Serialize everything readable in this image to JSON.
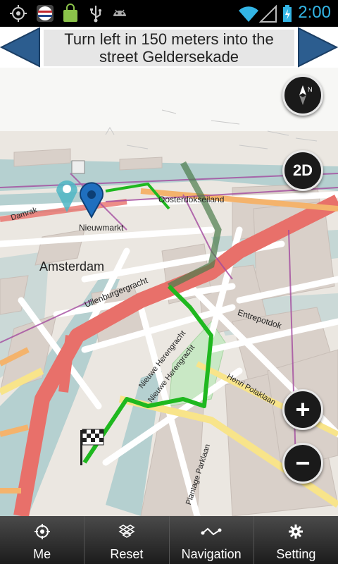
{
  "status_bar": {
    "time": "2:00",
    "icons": [
      "gps-icon",
      "flag-app-icon",
      "shopping-bag-icon",
      "usb-icon",
      "android-icon",
      "wifi-icon",
      "signal-icon",
      "battery-icon"
    ]
  },
  "instruction": {
    "text": "Turn left in 150 meters into the street Geldersekade",
    "prev_icon": "left-arrow-icon",
    "next_icon": "right-arrow-icon"
  },
  "map": {
    "labels": {
      "nieuwmarkt": "Nieuwmarkt",
      "amsterdam": "Amsterdam",
      "oosterdokseiland": "Oosterdokseiland",
      "uilenburgergracht": "Uilenburgergracht",
      "entrepotdok": "Entrepotdok",
      "nieuwe_herengracht_1": "Nieuwe Herengracht",
      "nieuwe_herengracht_2": "Nieuwe Herengracht",
      "henri_polaklaan": "Henri Polaklaan",
      "plantage_parklaan": "Plantage Parklaan",
      "damrak": "Damrak"
    },
    "buttons": {
      "view_mode": "2D",
      "zoom_in": "+",
      "zoom_out": "−"
    },
    "colors": {
      "route": "#1fb81f",
      "major_road": "#e8706a",
      "water": "#b5d0d0"
    }
  },
  "bottom_nav": [
    {
      "label": "Me",
      "icon": "crosshair-icon"
    },
    {
      "label": "Reset",
      "icon": "dropbox-icon"
    },
    {
      "label": "Navigation",
      "icon": "route-icon"
    },
    {
      "label": "Setting",
      "icon": "gear-icon"
    }
  ]
}
